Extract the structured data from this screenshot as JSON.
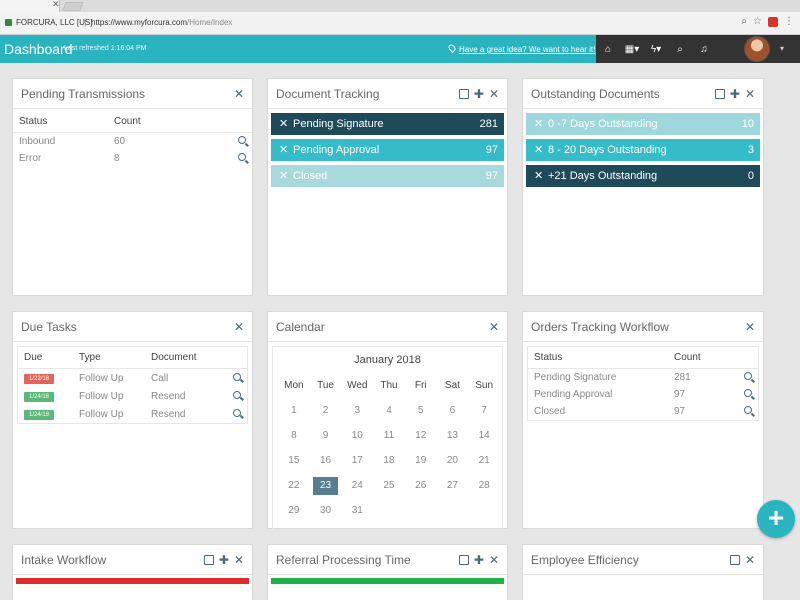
{
  "browser": {
    "site_name": "FORCURA, LLC [US]",
    "url_host": "https://www.myforcura.com",
    "url_path": "/Home/Index"
  },
  "header": {
    "title": "Dashboard",
    "refresh": "Last refreshed 1:16:04 PM",
    "idea_link": "Have a great idea? We want to hear it!",
    "accent_color": "#2ab4c0"
  },
  "pending_transmissions": {
    "title": "Pending Transmissions",
    "columns": [
      "Status",
      "Count"
    ],
    "rows": [
      {
        "status": "Inbound",
        "count": "60"
      },
      {
        "status": "Error",
        "count": "8"
      }
    ]
  },
  "document_tracking": {
    "title": "Document Tracking",
    "items": [
      {
        "label": "Pending Signature",
        "count": "281"
      },
      {
        "label": "Pending Approval",
        "count": "97"
      },
      {
        "label": "Closed",
        "count": "97"
      }
    ]
  },
  "outstanding_documents": {
    "title": "Outstanding Documents",
    "items": [
      {
        "label": "0 -7 Days Outstanding",
        "count": "10"
      },
      {
        "label": "8 - 20 Days Outstanding",
        "count": "3"
      },
      {
        "label": "+21 Days Outstanding",
        "count": "0"
      }
    ]
  },
  "due_tasks": {
    "title": "Due Tasks",
    "columns": [
      "Due",
      "Type",
      "Document"
    ],
    "rows": [
      {
        "due": "1/22/18",
        "type": "Follow Up",
        "document": "Call",
        "status": "overdue"
      },
      {
        "due": "1/24/18",
        "type": "Follow Up",
        "document": "Resend",
        "status": "upcoming"
      },
      {
        "due": "1/24/18",
        "type": "Follow Up",
        "document": "Resend",
        "status": "upcoming"
      }
    ]
  },
  "calendar": {
    "title": "Calendar",
    "month": "January 2018",
    "weekdays": [
      "Mon",
      "Tue",
      "Wed",
      "Thu",
      "Fri",
      "Sat",
      "Sun"
    ],
    "days": [
      "1",
      "2",
      "3",
      "4",
      "5",
      "6",
      "7",
      "8",
      "9",
      "10",
      "11",
      "12",
      "13",
      "14",
      "15",
      "16",
      "17",
      "18",
      "19",
      "20",
      "21",
      "22",
      "23",
      "24",
      "25",
      "26",
      "27",
      "28",
      "29",
      "30",
      "31"
    ],
    "selected": "23"
  },
  "orders_workflow": {
    "title": "Orders Tracking Workflow",
    "columns": [
      "Status",
      "Count"
    ],
    "rows": [
      {
        "status": "Pending Signature",
        "count": "281"
      },
      {
        "status": "Pending Approval",
        "count": "97"
      },
      {
        "status": "Closed",
        "count": "97"
      }
    ]
  },
  "intake_workflow": {
    "title": "Intake Workflow"
  },
  "referral_processing": {
    "title": "Referral Processing Time"
  },
  "employee_efficiency": {
    "title": "Employee Efficiency"
  },
  "colors": {
    "dark": "#1e4a5a",
    "teal": "#36bcc8",
    "light": "#a8d9dc",
    "red": "#e02b2b",
    "green": "#22b04b"
  }
}
